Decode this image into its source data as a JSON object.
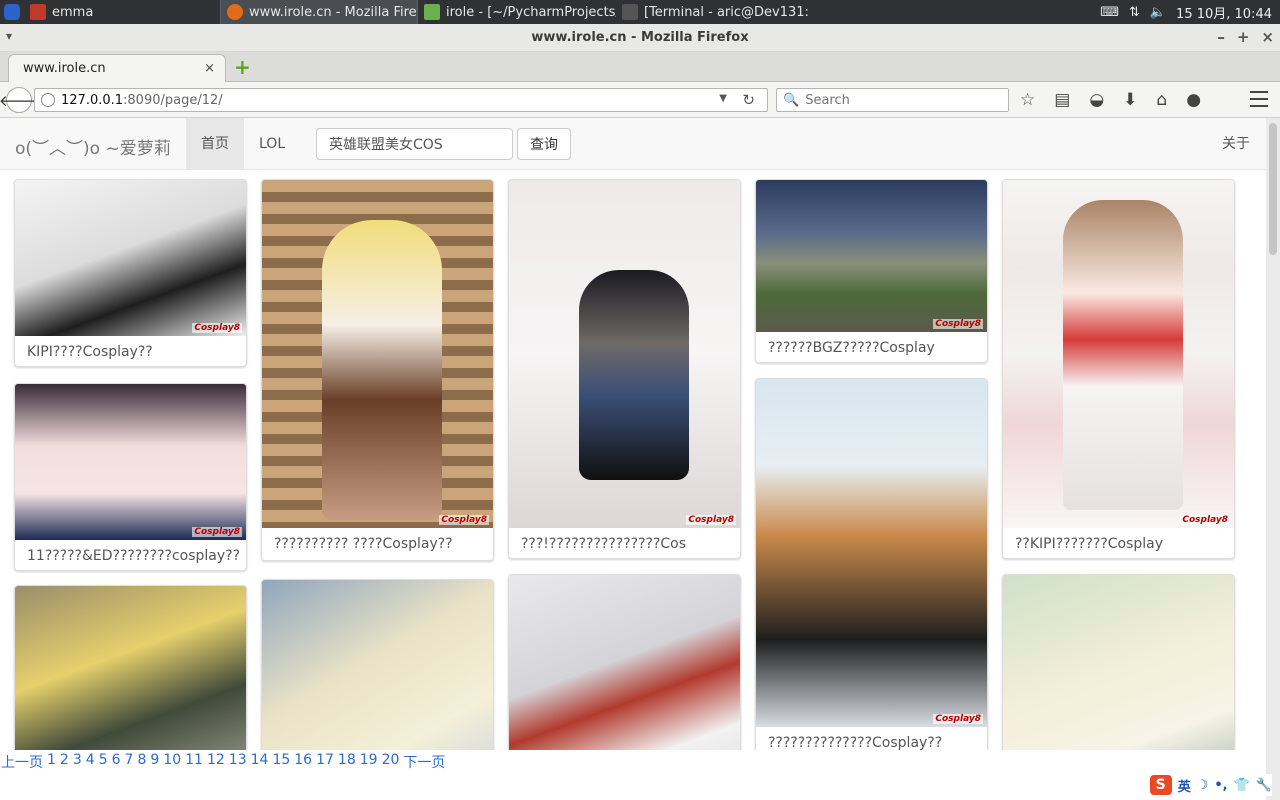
{
  "taskbar": {
    "tasks": [
      {
        "label": "emma",
        "color": "#c0392b"
      },
      {
        "label": "www.irole.cn - Mozilla Firef...",
        "color": "#e36a1b"
      },
      {
        "label": "irole - [~/PycharmProjects/...",
        "color": "#6ab04c"
      },
      {
        "label": "[Terminal - aric@Dev131: ~...",
        "color": "#555555"
      }
    ],
    "clock": "15 10月, 10:44"
  },
  "window": {
    "title": "www.irole.cn - Mozilla Firefox"
  },
  "tab": {
    "label": "www.irole.cn",
    "close": "×",
    "new": "+"
  },
  "nav": {
    "url_host": "127.0.0.1",
    "url_path": ":8090/page/12/",
    "search_placeholder": "Search"
  },
  "site": {
    "brand": "o(︶︿︶)o ~爱萝莉",
    "nav_home": "首页",
    "nav_lol": "LOL",
    "search_value": "英雄联盟美女COS",
    "search_button": "查询",
    "about": "关于",
    "watermark": "Cosplay8"
  },
  "cards": [
    {
      "caption": "KIPI????Cosplay??",
      "colors": [
        "#f2f2f2",
        "#2a2a2a"
      ]
    },
    {
      "caption": "11?????&ED????????cosplay??",
      "colors": [
        "#f3dede",
        "#3a2b3a"
      ]
    },
    {
      "caption": "",
      "colors": [
        "#c9b27a",
        "#404a3a"
      ]
    },
    {
      "caption": "?????????? ????Cosplay??",
      "colors": [
        "#b9a58a",
        "#8a5a3a"
      ]
    },
    {
      "caption": "",
      "colors": [
        "#b4c8dd",
        "#f0e8d0"
      ]
    },
    {
      "caption": "???!???????????????Cos",
      "colors": [
        "#f1efef",
        "#d9d4d2"
      ]
    },
    {
      "caption": "",
      "colors": [
        "#e7e7ea",
        "#b23a2e"
      ]
    },
    {
      "caption": "??????BGZ?????Cosplay",
      "colors": [
        "#3a4a6a",
        "#4c6a3a"
      ]
    },
    {
      "caption": "??????????????Cosplay??",
      "colors": [
        "#d8e6ef",
        "#2a2a2a"
      ]
    },
    {
      "caption": "??KIPI???????Cosplay",
      "colors": [
        "#f4f2f1",
        "#d63a3a"
      ]
    },
    {
      "caption": "",
      "colors": [
        "#cfe0c8",
        "#f4efd8"
      ]
    }
  ],
  "pager": {
    "prev": "上一页",
    "pages": [
      "1",
      "2",
      "3",
      "4",
      "5",
      "6",
      "7",
      "8",
      "9",
      "10",
      "11",
      "12",
      "13",
      "14",
      "15",
      "16",
      "17",
      "18",
      "19",
      "20"
    ],
    "next": "下一页"
  },
  "ime": {
    "logo": "S",
    "lang": "英"
  }
}
